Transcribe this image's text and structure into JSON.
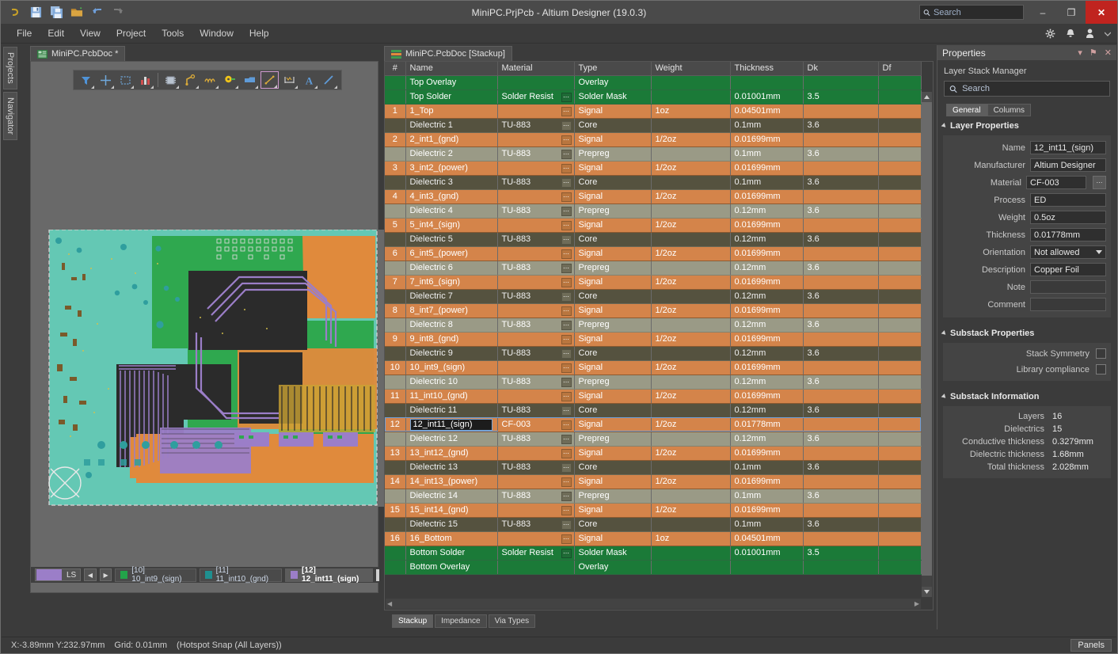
{
  "window": {
    "title": "MiniPC.PrjPcb - Altium Designer (19.0.3)",
    "minimize_label": "–",
    "maximize_label": "❐",
    "close_label": "✕"
  },
  "quick_access": [
    {
      "name": "altium-logo-icon",
      "label": "A"
    },
    {
      "name": "save-icon",
      "label": "Save"
    },
    {
      "name": "save-all-icon",
      "label": "Save All"
    },
    {
      "name": "open-folder-icon",
      "label": "Open"
    },
    {
      "name": "undo-icon",
      "label": "Undo"
    },
    {
      "name": "redo-icon",
      "label": "Redo"
    }
  ],
  "top_search": {
    "placeholder": "Search",
    "value": ""
  },
  "menu": [
    {
      "label": "File",
      "accel": "F"
    },
    {
      "label": "Edit",
      "accel": "E"
    },
    {
      "label": "View",
      "accel": "V"
    },
    {
      "label": "Project",
      "accel": "j"
    },
    {
      "label": "Tools",
      "accel": "T"
    },
    {
      "label": "Window",
      "accel": "W"
    },
    {
      "label": "Help",
      "accel": "H"
    }
  ],
  "menu_right": [
    {
      "name": "gear-icon",
      "label": "Preferences"
    },
    {
      "name": "bell-icon",
      "label": "Notifications"
    },
    {
      "name": "user-icon",
      "label": "Account"
    },
    {
      "name": "chevron-down-icon",
      "label": "More"
    }
  ],
  "vertical_tabs": [
    {
      "label": "Projects"
    },
    {
      "label": "Navigator"
    }
  ],
  "pcb_document": {
    "tab_label": "MiniPC.PcbDoc *",
    "toolbar": [
      {
        "name": "filter-icon"
      },
      {
        "name": "crosshair-place-icon"
      },
      {
        "name": "select-area-icon"
      },
      {
        "name": "bar-chart-icon"
      },
      {
        "name": "component-icon"
      },
      {
        "name": "route-trace-icon"
      },
      {
        "name": "wave-signal-icon"
      },
      {
        "name": "via-pad-icon"
      },
      {
        "name": "polygon-pour-icon"
      },
      {
        "name": "measure-line-icon"
      },
      {
        "name": "dimension-icon"
      },
      {
        "name": "text-icon"
      },
      {
        "name": "line-icon"
      }
    ]
  },
  "layer_tabs": {
    "ls_label": "LS",
    "ls_color": "#9b7ec8",
    "prev_label": "◀",
    "next_label": "▶",
    "tabs": [
      {
        "label": "[10] 10_int9_(sign)",
        "color": "#23a34a",
        "active": false
      },
      {
        "label": "[11] 11_int10_(gnd)",
        "color": "#1f8f8f",
        "active": false
      },
      {
        "label": "[12] 12_int11_(sign)",
        "color": "#9b7ec8",
        "active": true
      }
    ]
  },
  "stackup": {
    "tab_label": "MiniPC.PcbDoc [Stackup]",
    "columns": [
      "#",
      "Name",
      "Material",
      "Type",
      "Weight",
      "Thickness",
      "Dk",
      "Df"
    ],
    "bottom_tabs": [
      {
        "label": "Stackup",
        "active": true
      },
      {
        "label": "Impedance",
        "active": false
      },
      {
        "label": "Via Types",
        "active": false
      }
    ],
    "material_button_label": "⋯",
    "rows": [
      {
        "num": "",
        "name": "Top Overlay",
        "material": "",
        "type": "Overlay",
        "weight": "",
        "thickness": "",
        "dk": "",
        "df": "",
        "kind": "overlay",
        "mat_btn": false
      },
      {
        "num": "",
        "name": "Top Solder",
        "material": "Solder Resist",
        "type": "Solder Mask",
        "weight": "",
        "thickness": "0.01001mm",
        "dk": "3.5",
        "df": "",
        "kind": "solder",
        "mat_btn": true
      },
      {
        "num": "1",
        "name": "1_Top",
        "material": "",
        "type": "Signal",
        "weight": "1oz",
        "thickness": "0.04501mm",
        "dk": "",
        "df": "",
        "kind": "signal",
        "mat_btn": true
      },
      {
        "num": "",
        "name": "Dielectric 1",
        "material": "TU-883",
        "type": "Core",
        "weight": "",
        "thickness": "0.1mm",
        "dk": "3.6",
        "df": "",
        "kind": "core",
        "mat_btn": true
      },
      {
        "num": "2",
        "name": "2_int1_(gnd)",
        "material": "",
        "type": "Signal",
        "weight": "1/2oz",
        "thickness": "0.01699mm",
        "dk": "",
        "df": "",
        "kind": "signal",
        "mat_btn": true
      },
      {
        "num": "",
        "name": "Dielectric 2",
        "material": "TU-883",
        "type": "Prepreg",
        "weight": "",
        "thickness": "0.1mm",
        "dk": "3.6",
        "df": "",
        "kind": "prepreg",
        "mat_btn": true
      },
      {
        "num": "3",
        "name": "3_int2_(power)",
        "material": "",
        "type": "Signal",
        "weight": "1/2oz",
        "thickness": "0.01699mm",
        "dk": "",
        "df": "",
        "kind": "signal",
        "mat_btn": true
      },
      {
        "num": "",
        "name": "Dielectric 3",
        "material": "TU-883",
        "type": "Core",
        "weight": "",
        "thickness": "0.1mm",
        "dk": "3.6",
        "df": "",
        "kind": "core",
        "mat_btn": true
      },
      {
        "num": "4",
        "name": "4_int3_(gnd)",
        "material": "",
        "type": "Signal",
        "weight": "1/2oz",
        "thickness": "0.01699mm",
        "dk": "",
        "df": "",
        "kind": "signal",
        "mat_btn": true
      },
      {
        "num": "",
        "name": "Dielectric 4",
        "material": "TU-883",
        "type": "Prepreg",
        "weight": "",
        "thickness": "0.12mm",
        "dk": "3.6",
        "df": "",
        "kind": "prepreg",
        "mat_btn": true
      },
      {
        "num": "5",
        "name": "5_int4_(sign)",
        "material": "",
        "type": "Signal",
        "weight": "1/2oz",
        "thickness": "0.01699mm",
        "dk": "",
        "df": "",
        "kind": "signal",
        "mat_btn": true
      },
      {
        "num": "",
        "name": "Dielectric 5",
        "material": "TU-883",
        "type": "Core",
        "weight": "",
        "thickness": "0.12mm",
        "dk": "3.6",
        "df": "",
        "kind": "core",
        "mat_btn": true
      },
      {
        "num": "6",
        "name": "6_int5_(power)",
        "material": "",
        "type": "Signal",
        "weight": "1/2oz",
        "thickness": "0.01699mm",
        "dk": "",
        "df": "",
        "kind": "signal",
        "mat_btn": true
      },
      {
        "num": "",
        "name": "Dielectric 6",
        "material": "TU-883",
        "type": "Prepreg",
        "weight": "",
        "thickness": "0.12mm",
        "dk": "3.6",
        "df": "",
        "kind": "prepreg",
        "mat_btn": true
      },
      {
        "num": "7",
        "name": "7_int6_(sign)",
        "material": "",
        "type": "Signal",
        "weight": "1/2oz",
        "thickness": "0.01699mm",
        "dk": "",
        "df": "",
        "kind": "signal",
        "mat_btn": true
      },
      {
        "num": "",
        "name": "Dielectric 7",
        "material": "TU-883",
        "type": "Core",
        "weight": "",
        "thickness": "0.12mm",
        "dk": "3.6",
        "df": "",
        "kind": "core",
        "mat_btn": true
      },
      {
        "num": "8",
        "name": "8_int7_(power)",
        "material": "",
        "type": "Signal",
        "weight": "1/2oz",
        "thickness": "0.01699mm",
        "dk": "",
        "df": "",
        "kind": "signal",
        "mat_btn": true
      },
      {
        "num": "",
        "name": "Dielectric 8",
        "material": "TU-883",
        "type": "Prepreg",
        "weight": "",
        "thickness": "0.12mm",
        "dk": "3.6",
        "df": "",
        "kind": "prepreg",
        "mat_btn": true
      },
      {
        "num": "9",
        "name": "9_int8_(gnd)",
        "material": "",
        "type": "Signal",
        "weight": "1/2oz",
        "thickness": "0.01699mm",
        "dk": "",
        "df": "",
        "kind": "signal",
        "mat_btn": true
      },
      {
        "num": "",
        "name": "Dielectric 9",
        "material": "TU-883",
        "type": "Core",
        "weight": "",
        "thickness": "0.12mm",
        "dk": "3.6",
        "df": "",
        "kind": "core",
        "mat_btn": true
      },
      {
        "num": "10",
        "name": "10_int9_(sign)",
        "material": "",
        "type": "Signal",
        "weight": "1/2oz",
        "thickness": "0.01699mm",
        "dk": "",
        "df": "",
        "kind": "signal",
        "mat_btn": true
      },
      {
        "num": "",
        "name": "Dielectric 10",
        "material": "TU-883",
        "type": "Prepreg",
        "weight": "",
        "thickness": "0.12mm",
        "dk": "3.6",
        "df": "",
        "kind": "prepreg",
        "mat_btn": true
      },
      {
        "num": "11",
        "name": "11_int10_(gnd)",
        "material": "",
        "type": "Signal",
        "weight": "1/2oz",
        "thickness": "0.01699mm",
        "dk": "",
        "df": "",
        "kind": "signal",
        "mat_btn": true
      },
      {
        "num": "",
        "name": "Dielectric 11",
        "material": "TU-883",
        "type": "Core",
        "weight": "",
        "thickness": "0.12mm",
        "dk": "3.6",
        "df": "",
        "kind": "core",
        "mat_btn": true
      },
      {
        "num": "12",
        "name": "12_int11_(sign)",
        "material": "CF-003",
        "type": "Signal",
        "weight": "1/2oz",
        "thickness": "0.01778mm",
        "dk": "",
        "df": "",
        "kind": "signal",
        "mat_btn": true,
        "selected": true
      },
      {
        "num": "",
        "name": "Dielectric 12",
        "material": "TU-883",
        "type": "Prepreg",
        "weight": "",
        "thickness": "0.12mm",
        "dk": "3.6",
        "df": "",
        "kind": "prepreg",
        "mat_btn": true
      },
      {
        "num": "13",
        "name": "13_int12_(gnd)",
        "material": "",
        "type": "Signal",
        "weight": "1/2oz",
        "thickness": "0.01699mm",
        "dk": "",
        "df": "",
        "kind": "signal",
        "mat_btn": true
      },
      {
        "num": "",
        "name": "Dielectric 13",
        "material": "TU-883",
        "type": "Core",
        "weight": "",
        "thickness": "0.1mm",
        "dk": "3.6",
        "df": "",
        "kind": "core",
        "mat_btn": true
      },
      {
        "num": "14",
        "name": "14_int13_(power)",
        "material": "",
        "type": "Signal",
        "weight": "1/2oz",
        "thickness": "0.01699mm",
        "dk": "",
        "df": "",
        "kind": "signal",
        "mat_btn": true
      },
      {
        "num": "",
        "name": "Dielectric 14",
        "material": "TU-883",
        "type": "Prepreg",
        "weight": "",
        "thickness": "0.1mm",
        "dk": "3.6",
        "df": "",
        "kind": "prepreg",
        "mat_btn": true
      },
      {
        "num": "15",
        "name": "15_int14_(gnd)",
        "material": "",
        "type": "Signal",
        "weight": "1/2oz",
        "thickness": "0.01699mm",
        "dk": "",
        "df": "",
        "kind": "signal",
        "mat_btn": true
      },
      {
        "num": "",
        "name": "Dielectric 15",
        "material": "TU-883",
        "type": "Core",
        "weight": "",
        "thickness": "0.1mm",
        "dk": "3.6",
        "df": "",
        "kind": "core",
        "mat_btn": true
      },
      {
        "num": "16",
        "name": "16_Bottom",
        "material": "",
        "type": "Signal",
        "weight": "1oz",
        "thickness": "0.04501mm",
        "dk": "",
        "df": "",
        "kind": "signal",
        "mat_btn": true
      },
      {
        "num": "",
        "name": "Bottom Solder",
        "material": "Solder Resist",
        "type": "Solder Mask",
        "weight": "",
        "thickness": "0.01001mm",
        "dk": "3.5",
        "df": "",
        "kind": "solder",
        "mat_btn": true
      },
      {
        "num": "",
        "name": "Bottom Overlay",
        "material": "",
        "type": "Overlay",
        "weight": "",
        "thickness": "",
        "dk": "",
        "df": "",
        "kind": "overlay",
        "mat_btn": false
      }
    ]
  },
  "properties": {
    "title": "Properties",
    "header_icons": [
      {
        "name": "chevron-down-icon",
        "glyph": "▾"
      },
      {
        "name": "pin-icon",
        "glyph": "⚑"
      },
      {
        "name": "close-icon",
        "glyph": "✕"
      }
    ],
    "subtitle": "Layer Stack Manager",
    "search": {
      "placeholder": "Search",
      "value": ""
    },
    "tabs": [
      {
        "label": "General",
        "active": true
      },
      {
        "label": "Columns",
        "active": false
      }
    ],
    "layer_properties": {
      "section_label": "Layer Properties",
      "fields": [
        {
          "label": "Name",
          "value": "12_int11_(sign)",
          "kind": "text"
        },
        {
          "label": "Manufacturer",
          "value": "Altium Designer",
          "kind": "text"
        },
        {
          "label": "Material",
          "value": "CF-003",
          "kind": "text-button",
          "button_label": "⋯"
        },
        {
          "label": "Process",
          "value": "ED",
          "kind": "text"
        },
        {
          "label": "Weight",
          "value": "0.5oz",
          "kind": "text"
        },
        {
          "label": "Thickness",
          "value": "0.01778mm",
          "kind": "text"
        },
        {
          "label": "Orientation",
          "value": "Not allowed",
          "kind": "dropdown"
        },
        {
          "label": "Description",
          "value": "Copper Foil",
          "kind": "text"
        },
        {
          "label": "Note",
          "value": "",
          "kind": "text"
        },
        {
          "label": "Comment",
          "value": "",
          "kind": "text"
        }
      ]
    },
    "substack_properties": {
      "section_label": "Substack Properties",
      "checkboxes": [
        {
          "label": "Stack Symmetry",
          "checked": false
        },
        {
          "label": "Library compliance",
          "checked": false
        }
      ]
    },
    "substack_information": {
      "section_label": "Substack Information",
      "rows": [
        {
          "label": "Layers",
          "value": "16"
        },
        {
          "label": "Dielectrics",
          "value": "15"
        },
        {
          "label": "Conductive thickness",
          "value": "0.3279mm"
        },
        {
          "label": "Dielectric thickness",
          "value": "1.68mm"
        },
        {
          "label": "Total thickness",
          "value": "2.028mm"
        }
      ]
    }
  },
  "statusbar": {
    "coords": "X:-3.89mm Y:232.97mm",
    "grid": "Grid: 0.01mm",
    "snap": "(Hotspot Snap (All Layers))",
    "panels_label": "Panels"
  }
}
